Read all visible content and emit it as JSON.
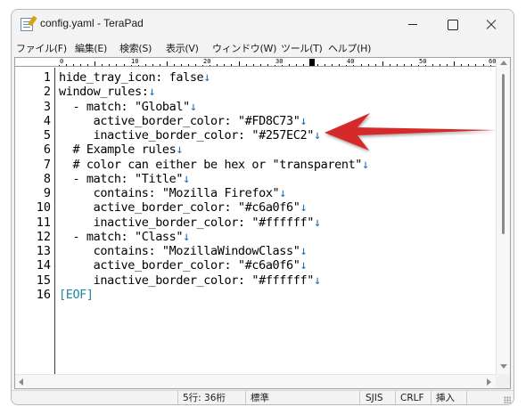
{
  "window": {
    "title": "config.yaml - TeraPad",
    "icon": "terapad-notepad-icon"
  },
  "menu": [
    {
      "label": "ファイル(F)"
    },
    {
      "label": "編集(E)"
    },
    {
      "label": "検索(S)"
    },
    {
      "label": "表示(V)"
    },
    {
      "label": "ウィンドウ(W)"
    },
    {
      "label": "ツール(T)"
    },
    {
      "label": "ヘルプ(H)"
    }
  ],
  "ruler": {
    "labels": [
      "0",
      "10",
      "20",
      "30",
      "40",
      "50",
      "60"
    ]
  },
  "editor": {
    "lines": [
      {
        "num": "1",
        "text": "hide_tray_icon: false"
      },
      {
        "num": "2",
        "text": "window_rules:"
      },
      {
        "num": "3",
        "text": "  - match: \"Global\""
      },
      {
        "num": "4",
        "text": "     active_border_color: \"#FD8C73\""
      },
      {
        "num": "5",
        "text": "     inactive_border_color: \"#257EC2\""
      },
      {
        "num": "6",
        "text": "  # Example rules"
      },
      {
        "num": "7",
        "text": "  # color can either be hex or \"transparent\""
      },
      {
        "num": "8",
        "text": "  - match: \"Title\""
      },
      {
        "num": "9",
        "text": "     contains: \"Mozilla Firefox\""
      },
      {
        "num": "10",
        "text": "     active_border_color: \"#c6a0f6\""
      },
      {
        "num": "11",
        "text": "     inactive_border_color: \"#ffffff\""
      },
      {
        "num": "12",
        "text": "  - match: \"Class\""
      },
      {
        "num": "13",
        "text": "     contains: \"MozillaWindowClass\""
      },
      {
        "num": "14",
        "text": "     active_border_color: \"#c6a0f6\""
      },
      {
        "num": "15",
        "text": "     inactive_border_color: \"#ffffff\""
      },
      {
        "num": "16",
        "text": "[EOF]"
      }
    ],
    "newline_glyph": "↓",
    "newline_color": "#1c6fb8",
    "eof_color": "#1c8aa8"
  },
  "annotation": {
    "arrow_color": "#d42a2a"
  },
  "status": {
    "position": "5行:  36桁",
    "mode": "標準",
    "encoding": "SJIS",
    "line_ending": "CRLF",
    "insert_mode": "挿入"
  }
}
